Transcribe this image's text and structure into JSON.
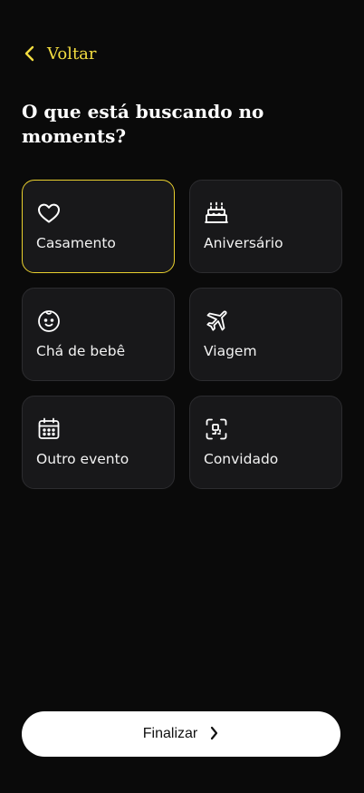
{
  "colors": {
    "background": "#0a0a0a",
    "accent": "#f3dd40",
    "card": "#18181a",
    "card_border": "#2c2c2f",
    "selected_border": "#e8cf2e",
    "button": "#ffffff"
  },
  "header": {
    "back_icon": "chevron-left-icon",
    "back_label": "Voltar",
    "title": "O que está buscando no moments?"
  },
  "options": [
    {
      "icon": "heart-icon",
      "label": "Casamento",
      "selected": true
    },
    {
      "icon": "birthday-cake-icon",
      "label": "Aniversário",
      "selected": false
    },
    {
      "icon": "baby-face-icon",
      "label": "Chá de bebê",
      "selected": false
    },
    {
      "icon": "airplane-icon",
      "label": "Viagem",
      "selected": false
    },
    {
      "icon": "calendar-icon",
      "label": "Outro evento",
      "selected": false
    },
    {
      "icon": "qr-scan-icon",
      "label": "Convidado",
      "selected": false
    }
  ],
  "footer": {
    "finish_label": "Finalizar",
    "finish_icon": "chevron-right-icon"
  }
}
